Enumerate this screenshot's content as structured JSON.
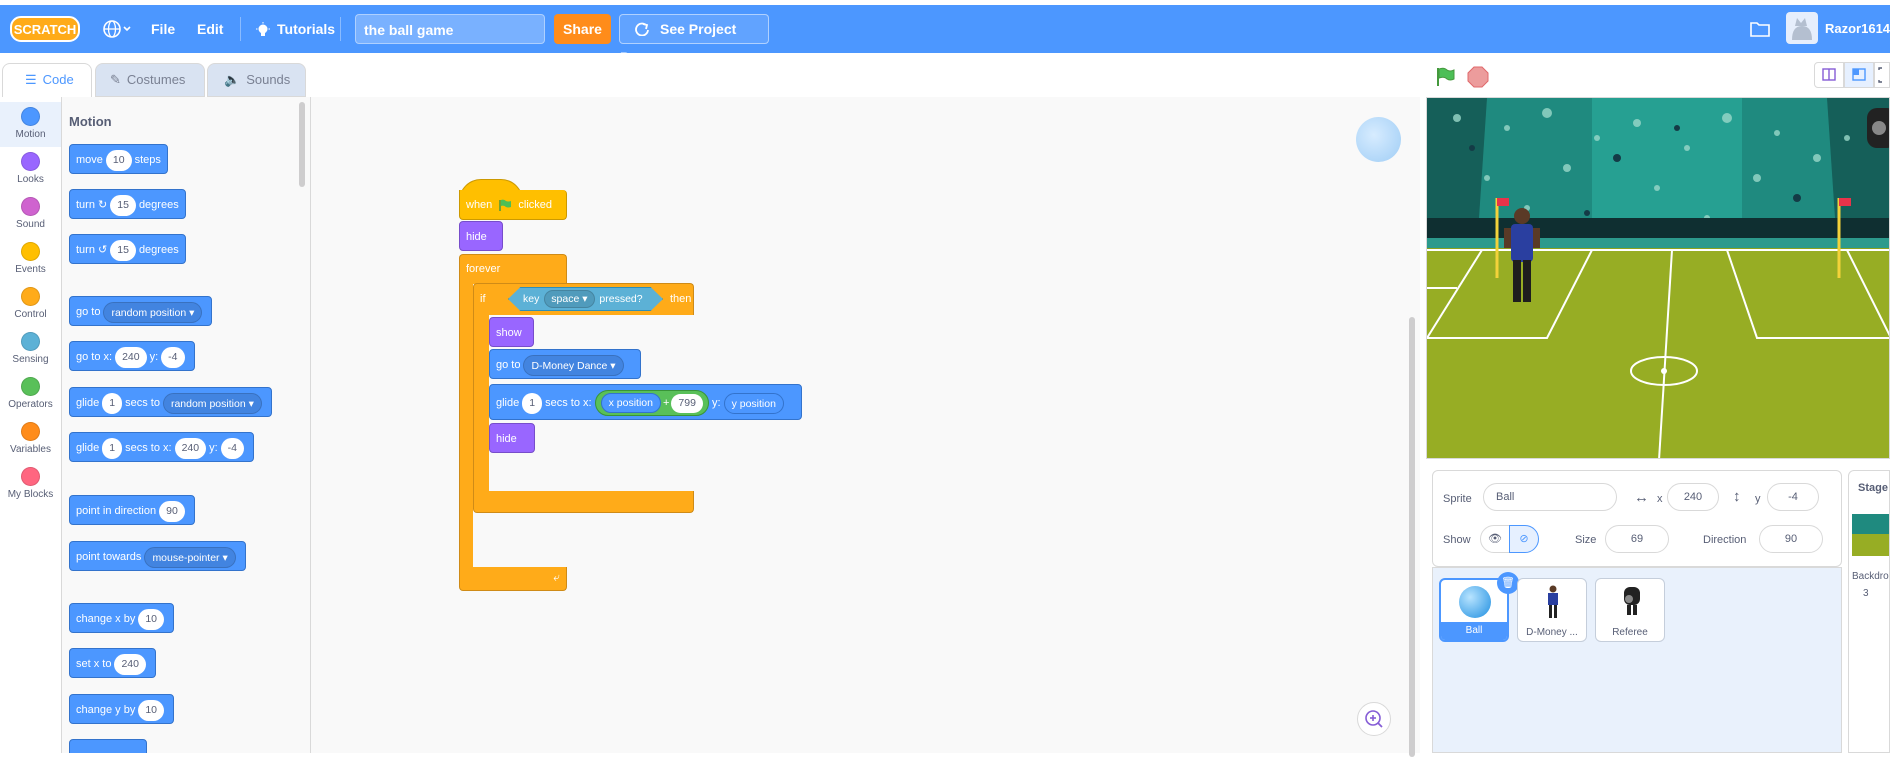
{
  "menubar": {
    "logo_text": "SCRATCH",
    "file_label": "File",
    "edit_label": "Edit",
    "tutorials_label": "Tutorials",
    "project_title": "the ball game",
    "share_label": "Share",
    "see_project_label": "See Project Page",
    "username": "Razor1614"
  },
  "tabs": [
    {
      "label": "Code"
    },
    {
      "label": "Costumes"
    },
    {
      "label": "Sounds"
    }
  ],
  "categories": [
    {
      "label": "Motion",
      "color": "#4c97ff"
    },
    {
      "label": "Looks",
      "color": "#9966ff"
    },
    {
      "label": "Sound",
      "color": "#cf63cf"
    },
    {
      "label": "Events",
      "color": "#ffbf00"
    },
    {
      "label": "Control",
      "color": "#ffab19"
    },
    {
      "label": "Sensing",
      "color": "#5cb1d6"
    },
    {
      "label": "Operators",
      "color": "#59c059"
    },
    {
      "label": "Variables",
      "color": "#ff8c1a"
    },
    {
      "label": "My Blocks",
      "color": "#ff6680"
    }
  ],
  "palette": {
    "heading": "Motion",
    "move": {
      "a": "move",
      "v": "10",
      "b": "steps"
    },
    "turn_right": {
      "a": "turn",
      "v": "15",
      "b": "degrees"
    },
    "turn_left": {
      "a": "turn",
      "v": "15",
      "b": "degrees"
    },
    "goto": {
      "a": "go to",
      "d": "random position"
    },
    "goto_xy": {
      "a": "go to x:",
      "x": "240",
      "b": "y:",
      "y": "-4"
    },
    "glide_to": {
      "a": "glide",
      "v": "1",
      "b": "secs to",
      "d": "random position"
    },
    "glide_xy": {
      "a": "glide",
      "v": "1",
      "b": "secs to x:",
      "x": "240",
      "c": "y:",
      "y": "-4"
    },
    "point_dir": {
      "a": "point in direction",
      "v": "90"
    },
    "point_towards": {
      "a": "point towards",
      "d": "mouse-pointer"
    },
    "change_x": {
      "a": "change x by",
      "v": "10"
    },
    "set_x": {
      "a": "set x to",
      "v": "240"
    },
    "change_y": {
      "a": "change y by",
      "v": "10"
    }
  },
  "script": {
    "when_a": "when",
    "when_b": "clicked",
    "hide1": "hide",
    "forever": "forever",
    "if": "if",
    "key": "key",
    "key_value": "space",
    "pressed": "pressed?",
    "then": "then",
    "show": "show",
    "goto": "go to",
    "goto_target": "D-Money Dance",
    "glide": "glide",
    "glide_secs": "1",
    "secs_to_x": "secs to x:",
    "x_position": "x position",
    "plus": "+",
    "plus_value": "799",
    "y_label": "y:",
    "y_position": "y position",
    "hide2": "hide"
  },
  "sprite_info": {
    "sprite_label": "Sprite",
    "sprite_name": "Ball",
    "x_label": "x",
    "x_value": "240",
    "y_label": "y",
    "y_value": "-4",
    "show_label": "Show",
    "size_label": "Size",
    "size_value": "69",
    "direction_label": "Direction",
    "direction_value": "90"
  },
  "sprites": [
    {
      "name": "Ball"
    },
    {
      "name": "D-Money ..."
    },
    {
      "name": "Referee"
    }
  ],
  "stage_pane": {
    "title": "Stage",
    "backdrops_label": "Backdrops",
    "backdrops_count": "3"
  }
}
